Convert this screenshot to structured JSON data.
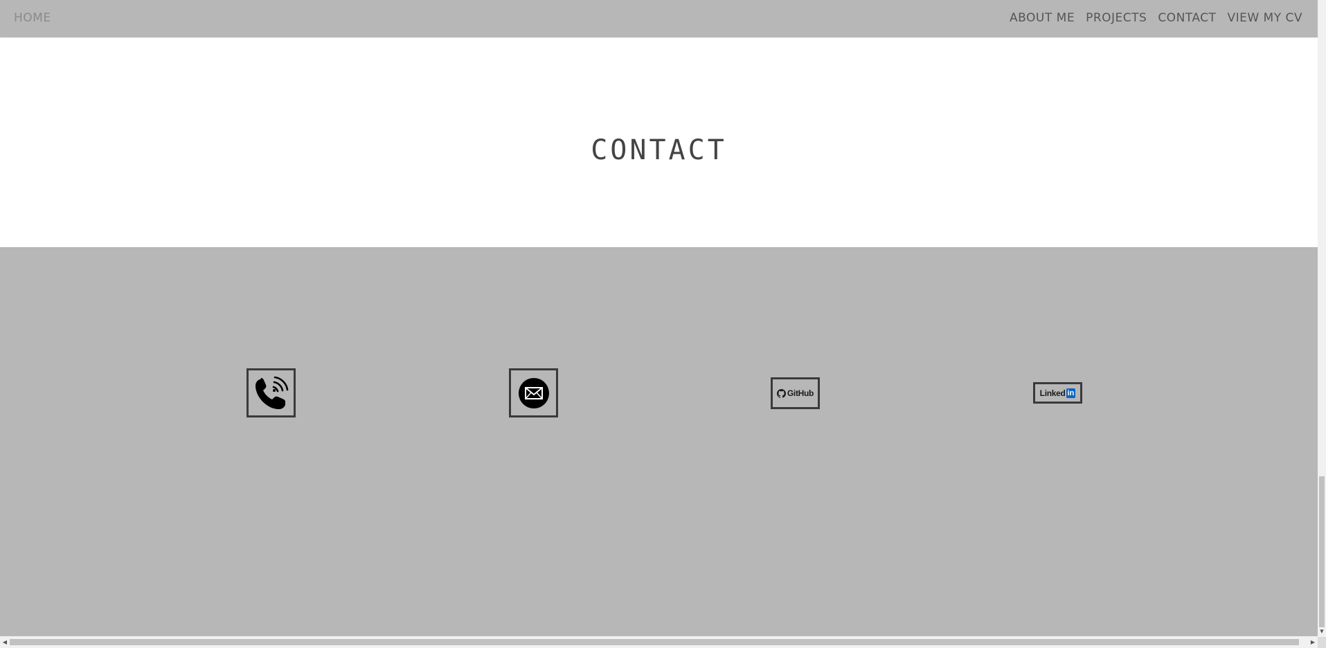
{
  "navbar": {
    "home_label": "HOME",
    "links": [
      {
        "label": "ABOUT ME"
      },
      {
        "label": "PROJECTS"
      },
      {
        "label": "CONTACT"
      },
      {
        "label": "VIEW MY CV"
      }
    ]
  },
  "section": {
    "title": "CONTACT"
  },
  "contacts": [
    {
      "icon": "phone-icon"
    },
    {
      "icon": "email-icon"
    },
    {
      "icon": "github-logo",
      "logo_text": "GitHub"
    },
    {
      "icon": "linkedin-logo",
      "logo_text": "Linked",
      "logo_badge": "in"
    }
  ],
  "colors": {
    "navbar_bg": "#b7b7b7",
    "contact_bg": "#b7b7b7",
    "home_text": "#8a8a8a",
    "nav_text": "#555555",
    "title_text": "#444444",
    "icon_border": "#3a3a3a",
    "linkedin_blue": "#0a66c2"
  }
}
